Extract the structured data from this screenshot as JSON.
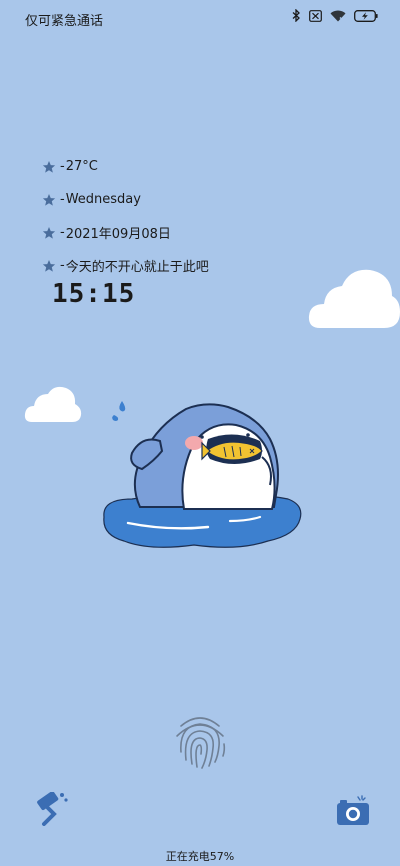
{
  "status_bar": {
    "carrier_text": "仅可紧急通话",
    "icons": [
      "bluetooth-icon",
      "sim-disabled-icon",
      "wifi-icon",
      "battery-charging-icon"
    ]
  },
  "widget": {
    "items": [
      {
        "icon": "star-icon",
        "text": "27°C"
      },
      {
        "icon": "star-icon",
        "text": "Wednesday"
      },
      {
        "icon": "star-icon",
        "text": "2021年09月08日"
      },
      {
        "icon": "star-icon",
        "text": "今天的不开心就止于此吧"
      }
    ],
    "dash": "-"
  },
  "clock": {
    "time": "15:15"
  },
  "shortcuts": {
    "left_icon": "paint-roller-icon",
    "right_icon": "camera-icon"
  },
  "charging": {
    "text": "正在充电57%"
  },
  "colors": {
    "background": "#a9c6ea",
    "star": "#4a6d9c",
    "water": "#3d80cf",
    "shark": "#7b9fd9",
    "shortcut": "#3b6db3"
  }
}
